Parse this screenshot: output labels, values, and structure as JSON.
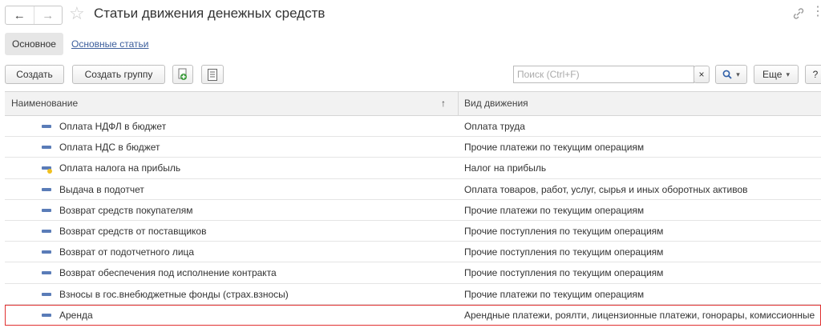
{
  "window": {
    "title": "Статьи движения денежных средств",
    "back_icon": "←",
    "forward_icon": "→",
    "star_icon": "☆",
    "link_icon": "🔗",
    "more_icon": "⋮"
  },
  "tabs": {
    "active": "Основное",
    "link": "Основные статьи"
  },
  "toolbar": {
    "create_label": "Создать",
    "create_group_label": "Создать группу",
    "search_placeholder": "Поиск (Ctrl+F)",
    "clear_label": "×",
    "search_icon": "🔍",
    "dropdown_caret": "▾",
    "more_label": "Еще",
    "help_label": "?"
  },
  "table": {
    "columns": [
      "Наименование",
      "Вид движения"
    ],
    "sort_icon": "↑",
    "rows": [
      {
        "name": "Оплата НДФЛ в бюджет",
        "kind": "Оплата труда",
        "icon": "item-icon"
      },
      {
        "name": "Оплата НДС в бюджет",
        "kind": "Прочие платежи по текущим операциям",
        "icon": "item-icon"
      },
      {
        "name": "Оплата налога на прибыль",
        "kind": "Налог на прибыль",
        "icon": "item-tax-icon"
      },
      {
        "name": "Выдача в подотчет",
        "kind": "Оплата товаров, работ, услуг, сырья и иных оборотных активов",
        "icon": "item-icon"
      },
      {
        "name": "Возврат средств покупателям",
        "kind": "Прочие платежи по текущим операциям",
        "icon": "item-icon"
      },
      {
        "name": "Возврат средств от поставщиков",
        "kind": "Прочие поступления по текущим операциям",
        "icon": "item-icon"
      },
      {
        "name": "Возврат от подотчетного лица",
        "kind": "Прочие поступления по текущим операциям",
        "icon": "item-icon"
      },
      {
        "name": "Возврат обеспечения под исполнение контракта",
        "kind": "Прочие поступления по текущим операциям",
        "icon": "item-icon"
      },
      {
        "name": "Взносы в гос.внебюджетные фонды (страх.взносы)",
        "kind": "Прочие платежи по текущим операциям",
        "icon": "item-icon"
      },
      {
        "name": "Аренда",
        "kind": "Арендные платежи, роялти, лицензионные платежи, гонорары, комиссионные",
        "icon": "item-icon"
      }
    ]
  }
}
